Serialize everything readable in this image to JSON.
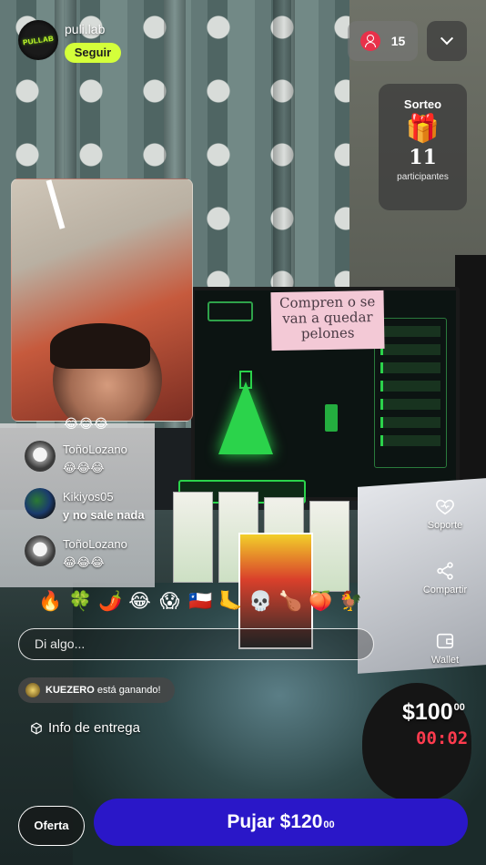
{
  "header": {
    "username": "puli.lab",
    "avatar_text": "PULLAB",
    "follow_label": "Seguir",
    "viewer_count": "15"
  },
  "giveaway": {
    "title": "Sorteo",
    "gift_icon": "🎁",
    "count": "11",
    "label": "participantes"
  },
  "stream_note": {
    "line1": "Compren o se",
    "line2": "van a quedar",
    "line3": "pelones"
  },
  "chat": {
    "partial_text": "😂😂😂",
    "messages": [
      {
        "user": "ToñoLozano",
        "text": "😂😂😂"
      },
      {
        "user": "Kikiyos05",
        "text": "y no sale nada"
      },
      {
        "user": "ToñoLozano",
        "text": "😂😂😂"
      }
    ],
    "input_placeholder": "Di algo..."
  },
  "reactions": [
    "🔥",
    "🍀",
    "🌶️",
    "😂",
    "😱",
    "🇨🇱",
    "🦶",
    "💀",
    "🍗",
    "🍑",
    "🐓"
  ],
  "side_actions": {
    "support": "Soporte",
    "share": "Compartir",
    "wallet": "Wallet"
  },
  "winning": {
    "user": "KUEZERO",
    "text": "está ganando!"
  },
  "delivery": {
    "icon": "📦",
    "label": "Info de entrega"
  },
  "auction": {
    "price_main": "$100",
    "price_cents": "00",
    "timer": "00:02"
  },
  "bottom": {
    "offer_label": "Oferta",
    "bid_main": "Pujar $120",
    "bid_cents": "00"
  },
  "colors": {
    "follow_bg": "#d4ff3a",
    "bid_bg": "#2a17c8",
    "timer": "#ff3b4e",
    "viewer_icon": "#e8314a"
  }
}
